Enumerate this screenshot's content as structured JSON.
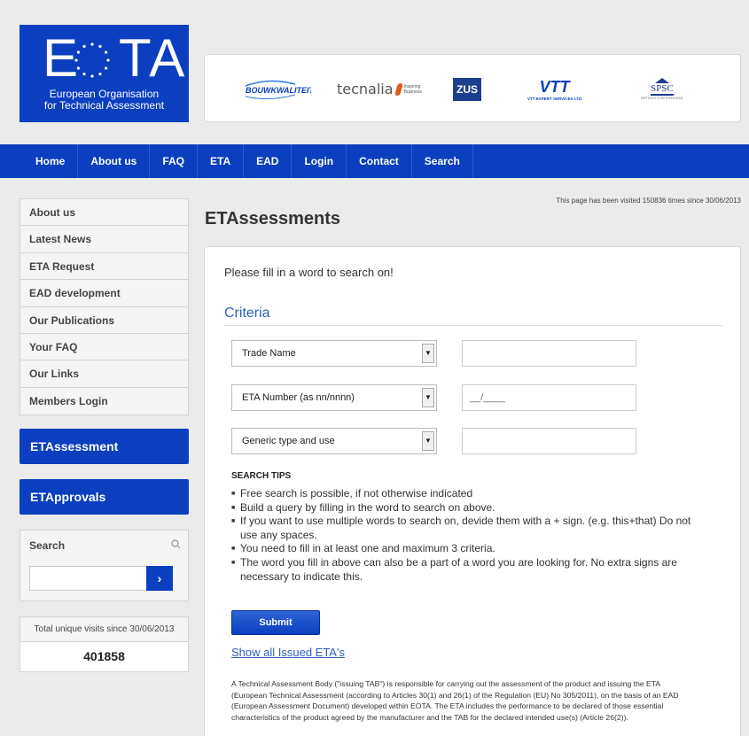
{
  "header": {
    "logo_mark": "E TA",
    "logo_text_line1": "European Organisation",
    "logo_text_line2": "for Technical Assessment",
    "partners": {
      "bouw": "BOUWKWALITEIT",
      "tecnalia": "tecnalia",
      "tecnalia_tag": "Inspiring Business",
      "zus": "ZUS",
      "vtt": "VTT",
      "vtt_sub": "VTT EXPERT SERVICES LTD",
      "spsc": "SPSC",
      "spsc_sub": "ΙΝΣΤΙΤΟΥΤΟ ΠΙΣΤΟΠΟΙΗΣΗΣ"
    }
  },
  "nav": [
    "Home",
    "About us",
    "FAQ",
    "ETA",
    "EAD",
    "Login",
    "Contact",
    "Search"
  ],
  "sidebar": {
    "items": [
      "About us",
      "Latest News",
      "ETA Request",
      "EAD development",
      "Our Publications",
      "Your FAQ",
      "Our Links",
      "Members Login"
    ],
    "btn_assessment": "ETAssessment",
    "btn_approvals": "ETApprovals",
    "search_label": "Search",
    "search_button": "›",
    "visits_label": "Total unique visits since 30/06/2013",
    "visits_count": "401858"
  },
  "main": {
    "visited_note": "This page has been visited 150836 times since 30/06/2013",
    "title": "ETAssessments",
    "intro": "Please fill in a word to search on!",
    "criteria_heading": "Criteria",
    "rows": [
      {
        "label": "Trade Name",
        "value": ""
      },
      {
        "label": "ETA Number (as nn/nnnn)",
        "value": "__/____"
      },
      {
        "label": "Generic type and use",
        "value": ""
      }
    ],
    "tips_heading": "SEARCH TIPS",
    "tips": [
      "Free search is possible, if not otherwise indicated",
      "Build a query by filling in the word to search on above.",
      "If you want to use multiple words to search on, devide them with a + sign. (e.g. this+that) Do not use any spaces.",
      "You need to fill in at least one and maximum 3 criteria.",
      "The word you fill in above can also be a part of a word you are looking for. No extra signs are necessary to indicate this."
    ],
    "submit_label": "Submit",
    "show_all_link": "Show all Issued ETA's",
    "footer_text": "A Technical Assessment Body (\"issuing TAB\") is responsible for carrying out the assessment of the product and issuing the ETA (European Technical Assessment (according to Articles 30(1) and 26(1) of the Regulation (EU) No 305/2011), on the basis of an EAD (European Assessment Document) developed within EOTA. The ETA includes the performance to be declared of those essential characteristics of the product agreed by the manufacturer and the TAB for the declared intended use(s) (Article 26(2))."
  },
  "colors": {
    "brand_blue": "#0b3fbf",
    "link_blue": "#2b5fbf",
    "page_bg": "#ebebeb"
  }
}
